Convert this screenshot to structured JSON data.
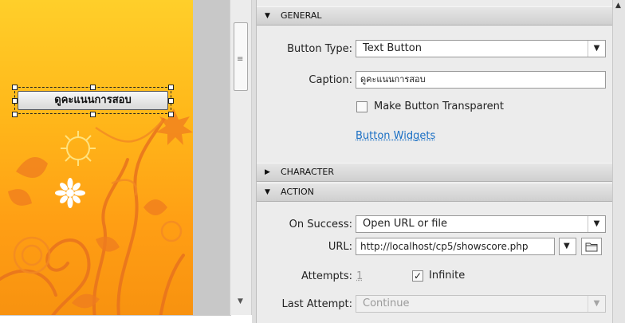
{
  "stage": {
    "button_caption": "ดูคะแนนการสอบ"
  },
  "panel": {
    "general": {
      "header": "GENERAL",
      "button_type_label": "Button Type:",
      "button_type_value": "Text Button",
      "caption_label": "Caption:",
      "caption_value": "ดูคะแนนการสอบ",
      "transparent_label": "Make Button Transparent",
      "transparent_checked": false,
      "widgets_link": "Button Widgets"
    },
    "character": {
      "header": "CHARACTER"
    },
    "action": {
      "header": "ACTION",
      "on_success_label": "On Success:",
      "on_success_value": "Open URL or file",
      "url_label": "URL:",
      "url_value": "http://localhost/cp5/showscore.php",
      "attempts_label": "Attempts:",
      "attempts_value": "1",
      "infinite_label": "Infinite",
      "infinite_checked": true,
      "last_attempt_label": "Last Attempt:",
      "last_attempt_value": "Continue"
    }
  },
  "icons": {
    "expanded": "triangle-down-icon",
    "collapsed": "triangle-right-icon",
    "folder": "folder-icon"
  },
  "colors": {
    "stage_top": "#ffcf2a",
    "stage_bottom": "#f7910f",
    "link": "#1a6fc4",
    "flower": "#e8731e"
  }
}
